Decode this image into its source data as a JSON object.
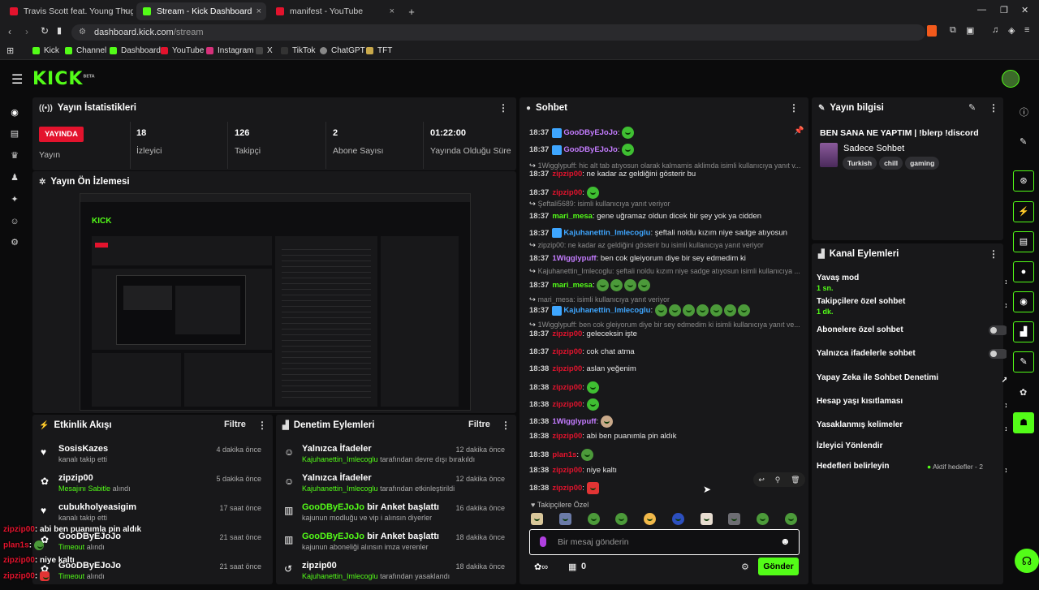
{
  "browser": {
    "tabs": [
      {
        "title": "Travis Scott feat. Young Thug & M.I.A.",
        "color": "#e3132d"
      },
      {
        "title": "Stream - Kick Dashboard",
        "color": "#53fc18"
      },
      {
        "title": "manifest - YouTube",
        "color": "#e3132d"
      }
    ],
    "new_tab": "+",
    "url_host": "dashboard.kick.com",
    "url_path": "/stream",
    "bookmarks": [
      "Kick",
      "Channel",
      "Dashboard",
      "YouTube",
      "Instagram",
      "X",
      "TikTok",
      "ChatGPT",
      "TFT"
    ]
  },
  "app": {
    "logo": "KICK",
    "logo_sup": "BETA"
  },
  "stats": {
    "title": "Yayın İstatistikleri",
    "live_badge": "YAYINDA",
    "live_label": "Yayın",
    "viewers_value": "18",
    "viewers_label": "İzleyici",
    "followers_value": "126",
    "followers_label": "Takipçi",
    "subs_value": "2",
    "subs_label": "Abone Sayısı",
    "duration_value": "01:22:00",
    "duration_label": "Yayında Olduğu Süre"
  },
  "preview": {
    "title": "Yayın Ön İzlemesi"
  },
  "activity": {
    "title": "Etkinlik Akışı",
    "filter": "Filtre",
    "items": [
      {
        "name": "SosisKazes",
        "desc": "kanalı takip etti",
        "time": "4 dakika önce"
      },
      {
        "name": "zipzip00",
        "hl": "Mesajını Sabitle",
        "desc": "alındı",
        "time": "5 dakika önce"
      },
      {
        "name": "cubukholyeasigim",
        "desc": "kanalı takip etti",
        "time": "17 saat önce"
      },
      {
        "name": "GooDByEJoJo",
        "hl": "Timeout",
        "desc": "alındı",
        "time": "21 saat önce"
      },
      {
        "name": "GooDByEJoJo",
        "hl": "Timeout",
        "desc": "alındı",
        "time": "21 saat önce"
      }
    ]
  },
  "moderation": {
    "title": "Denetim Eylemleri",
    "filter": "Filtre",
    "items": [
      {
        "name": "Yalnızca İfadeler",
        "hl": "Kajuhanettin_Imlecoglu",
        "desc": "tarafından devre dışı bırakıldı",
        "time": "12 dakika önce"
      },
      {
        "name": "Yalnızca İfadeler",
        "hl": "Kajuhanettin_Imlecoglu",
        "desc": "tarafından etkinleştirildi",
        "time": "12 dakika önce"
      },
      {
        "name": "GooDByEJoJo",
        "name2": "bir Anket başlattı",
        "desc": "kajunun modluğu ve vip i alınsın diyerler",
        "time": "16 dakika önce"
      },
      {
        "name": "GooDByEJoJo",
        "name2": "bir Anket başlattı",
        "desc": "kajunun aboneliği alınsın imza verenler",
        "time": "18 dakika önce"
      },
      {
        "name": "zipzip00",
        "hl": "Kajuhanettin_Imlecoglu",
        "desc": "tarafından yasaklandı",
        "time": "18 dakika önce"
      }
    ]
  },
  "chat": {
    "title": "Sohbet",
    "lines": [
      {
        "time": "18:37",
        "user": "GooDByEJoJo",
        "color": "#c47cff",
        "msg": ":",
        "emote": "green"
      },
      {
        "time": "18:37",
        "user": "GooDByEJoJo",
        "color": "#c47cff",
        "msg": ":",
        "emote": "green"
      },
      {
        "reply": "1Wigglypuff: hic alt tab atıyosun olarak kalmamis aklimda isimli kullanıcıya yanıt v..."
      },
      {
        "time": "18:37",
        "user": "zipzip00",
        "color": "#e3132d",
        "msg": ": ne kadar az geldiğini gösterir bu"
      },
      {
        "time": "18:37",
        "user": "zipzip00",
        "color": "#e3132d",
        "msg": ":",
        "emote": "green"
      },
      {
        "reply": "Şeftali5689: isimli kullanıcıya yanıt veriyor"
      },
      {
        "time": "18:37",
        "user": "mari_mesa",
        "color": "#53fc18",
        "msg": ": gene uğramaz oldun dicek bir şey yok ya cidden"
      },
      {
        "time": "18:37",
        "user": "Kajuhanettin_Imlecoglu",
        "color": "#3ea6ff",
        "msg": ": şeftali noldu kızım niye sadge atıyosun"
      },
      {
        "reply": "zipzip00: ne kadar az geldiğini gösterir bu isimli kullanıcıya yanıt veriyor"
      },
      {
        "time": "18:37",
        "user": "1Wigglypuff",
        "color": "#c47cff",
        "msg": ": ben cok gleiyorum diye bir sey edmedim ki"
      },
      {
        "reply": "Kajuhanettin_Imlecoglu: şeftali noldu kızım niye sadge atıyosun isimli kullanıcıya ..."
      },
      {
        "time": "18:37",
        "user": "mari_mesa",
        "color": "#53fc18",
        "msg": ":",
        "emote": "frog4"
      },
      {
        "reply": "mari_mesa: isimli kullanıcıya yanıt veriyor"
      },
      {
        "time": "18:37",
        "user": "Kajuhanettin_Imlecoglu",
        "color": "#3ea6ff",
        "msg": ":",
        "emote": "frog7"
      },
      {
        "reply": "1Wigglypuff: ben cok gleiyorum diye bir sey edmedim ki isimli kullanıcıya yanıt ve..."
      },
      {
        "time": "18:37",
        "user": "zipzip00",
        "color": "#e3132d",
        "msg": ": geleceksin işte"
      },
      {
        "time": "18:37",
        "user": "zipzip00",
        "color": "#e3132d",
        "msg": ": cok chat atma"
      },
      {
        "time": "18:38",
        "user": "zipzip00",
        "color": "#e3132d",
        "msg": ": aslan yeğenim"
      },
      {
        "time": "18:38",
        "user": "zipzip00",
        "color": "#e3132d",
        "msg": ":",
        "emote": "green"
      },
      {
        "time": "18:38",
        "user": "zipzip00",
        "color": "#e3132d",
        "msg": ":",
        "emote": "green"
      },
      {
        "time": "18:38",
        "user": "1Wigglypuff",
        "color": "#c47cff",
        "msg": ":",
        "emote": "face"
      },
      {
        "time": "18:38",
        "user": "zipzip00",
        "color": "#e3132d",
        "msg": ": abi ben puanımla pin aldık"
      },
      {
        "time": "18:38",
        "user": "plan1s",
        "color": "#e3132d",
        "msg": ":",
        "emote": "frog"
      },
      {
        "time": "18:38",
        "user": "zipzip00",
        "color": "#e3132d",
        "msg": ": niye kaltı"
      },
      {
        "time": "18:38",
        "user": "zipzip00",
        "color": "#e3132d",
        "msg": ":",
        "emote": "red"
      }
    ],
    "followers_only": "Takipçilere Özel",
    "input_placeholder": "Bir mesaj gönderin",
    "points": "0",
    "send": "Gönder"
  },
  "stream_info": {
    "title": "Yayın bilgisi",
    "stream_title": "BEN SANA NE YAPTIM | !blerp !discord",
    "category": "Sadece Sohbet",
    "tags": [
      "Turkish",
      "chill",
      "gaming"
    ]
  },
  "channel_actions": {
    "title": "Kanal Eylemleri",
    "slow_mode": "Yavaş mod",
    "slow_mode_value": "1 sn.",
    "followers_chat": "Takipçilere özel sohbet",
    "followers_chat_value": "1 dk.",
    "subs_chat": "Abonelere özel sohbet",
    "emote_chat": "Yalnızca ifadelerle sohbet",
    "ai_mod": "Yapay Zeka ile Sohbet Denetimi",
    "age_limit": "Hesap yaşı kısıtlaması",
    "banned_words": "Yasaklanmış kelimeler",
    "raid": "İzleyici Yönlendir",
    "goals": "Hedefleri belirleyin",
    "active_goals": "Aktif hedefler - 2"
  },
  "overlay_chat": [
    {
      "user": "zipzip00",
      "msg": ": abi ben puanımla pin aldık"
    },
    {
      "user": "plan1s",
      "msg": ":"
    },
    {
      "user": "zipzip00",
      "msg": ": niye kaltı"
    },
    {
      "user": "zipzip00",
      "msg": ":"
    }
  ],
  "colors": {
    "accent": "#53fc18",
    "live": "#e3132d",
    "panel": "#18181a"
  }
}
